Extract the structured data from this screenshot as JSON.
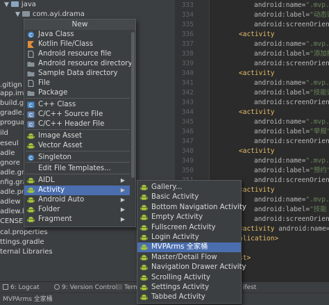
{
  "project_tree": {
    "java_label": "java",
    "package_label": "com.ayi.drama",
    "side_labels": [
      ".gitign",
      "app.im",
      "build.g",
      "gradle.",
      "proguar",
      "ild",
      "eseul",
      "adle",
      "gnore",
      "adle.gradl",
      "nfig.gradle",
      "adle.prop",
      "adlew",
      "adlew.ba",
      "CENSE",
      "cal.properties",
      "ttings.gradle",
      "ternal Libraries"
    ]
  },
  "editor": {
    "line_numbers": [
      "333",
      "334",
      "335",
      "336",
      "337",
      "338",
      "339",
      "340",
      "341",
      "342",
      "343",
      "344",
      "345",
      "346",
      "347",
      "348",
      "349",
      "350",
      "351",
      "352",
      "353",
      "354",
      "355",
      "356",
      "357",
      "358",
      "359",
      "360",
      "361",
      "362",
      "363",
      "364",
      "365",
      "366",
      "367",
      "368",
      "369",
      "370",
      "371",
      "372"
    ],
    "lines": [
      {
        "indent": 2,
        "attr": "android:name=",
        "val": "\".mvp.u"
      },
      {
        "indent": 2,
        "attr": "android:label=",
        "val": "\"动态详"
      },
      {
        "indent": 2,
        "attr": "android:screenOrienta",
        "val": ""
      },
      {
        "indent": 0,
        "tag": "<activity",
        "val": ""
      },
      {
        "indent": 2,
        "attr": "android:name=",
        "val": "\".mvp.u"
      },
      {
        "indent": 2,
        "attr": "android:label=",
        "val": "\"添加技"
      },
      {
        "indent": 2,
        "attr": "android:screenOrienta",
        "val": ""
      },
      {
        "indent": 0,
        "tag": "<activity",
        "val": ""
      },
      {
        "indent": 2,
        "attr": "android:name=",
        "val": "\".mvp.u"
      },
      {
        "indent": 2,
        "attr": "android:label=",
        "val": "\"技能详"
      },
      {
        "indent": 2,
        "attr": "android:screenOrienta",
        "val": ""
      },
      {
        "indent": 0,
        "tag": "<activity",
        "val": ""
      },
      {
        "indent": 2,
        "attr": "android:name=",
        "val": "\".mvp.u"
      },
      {
        "indent": 2,
        "attr": "android:label=",
        "val": "\"举报\""
      },
      {
        "indent": 2,
        "attr": "android:screenOrienta",
        "val": ""
      },
      {
        "indent": 0,
        "tag": "<activity",
        "val": ""
      },
      {
        "indent": 2,
        "attr": "android:name=",
        "val": "\".mvp.u"
      },
      {
        "indent": 2,
        "attr": "android:label=",
        "val": "\"预约\""
      },
      {
        "indent": 2,
        "attr": "android:screenOrienta",
        "val": ""
      },
      {
        "indent": 0,
        "tag": "<activity",
        "val": ""
      },
      {
        "indent": 2,
        "attr": "android:name=",
        "val": "\".mvp.u"
      },
      {
        "indent": 2,
        "attr": "android:label=",
        "val": "\"技能"
      },
      {
        "indent": 2,
        "attr": "android:screenOrienta",
        "val": ""
      },
      {
        "indent": 0,
        "tag": "<activity",
        "attr": " android:name=",
        "val": "\"."
      },
      {
        "indent": 0,
        "tag": "plication>",
        "val": ""
      },
      {
        "indent": 0,
        "tag": "",
        "val": ""
      },
      {
        "indent": 0,
        "tag": "st>",
        "val": ""
      }
    ]
  },
  "new_menu": {
    "title": "New",
    "items": [
      {
        "label": "Java Class",
        "icon": "java-class-icon",
        "color": "#4a88c7"
      },
      {
        "label": "Kotlin File/Class",
        "icon": "kotlin-icon",
        "color": "#e08d3c"
      },
      {
        "label": "Android resource file",
        "icon": "android-resource-file-icon",
        "color": "#a9b7c6"
      },
      {
        "label": "Android resource directory",
        "icon": "folder-icon",
        "color": "#87939a"
      },
      {
        "label": "Sample Data directory",
        "icon": "folder-icon",
        "color": "#87939a"
      },
      {
        "label": "File",
        "icon": "file-icon",
        "color": "#a9b7c6"
      },
      {
        "label": "Package",
        "icon": "package-icon",
        "color": "#87939a"
      },
      {
        "label": "C++ Class",
        "icon": "cpp-class-icon",
        "color": "#4a88c7"
      },
      {
        "label": "C/C++ Source File",
        "icon": "cpp-source-icon",
        "color": "#6a8bbb"
      },
      {
        "label": "C/C++ Header File",
        "icon": "cpp-header-icon",
        "color": "#6a8bbb"
      },
      {
        "label": "Image Asset",
        "icon": "android-icon",
        "color": "#a4c639"
      },
      {
        "label": "Vector Asset",
        "icon": "android-icon",
        "color": "#a4c639"
      },
      {
        "label": "Singleton",
        "icon": "singleton-icon",
        "color": "#4a88c7"
      },
      {
        "label": "Edit File Templates...",
        "icon": "",
        "color": ""
      },
      {
        "label": "AIDL",
        "icon": "android-icon",
        "color": "#a4c639"
      },
      {
        "label": "Activity",
        "icon": "android-icon",
        "color": "#a4c639"
      },
      {
        "label": "Android Auto",
        "icon": "android-icon",
        "color": "#a4c639"
      },
      {
        "label": "Folder",
        "icon": "android-icon",
        "color": "#a4c639"
      },
      {
        "label": "Fragment",
        "icon": "android-icon",
        "color": "#a4c639"
      }
    ],
    "selected": "Activity"
  },
  "activity_menu": {
    "items": [
      {
        "label": "Gallery..."
      },
      {
        "label": "Basic Activity"
      },
      {
        "label": "Bottom Navigation Activity"
      },
      {
        "label": "Empty Activity"
      },
      {
        "label": "Fullscreen Activity"
      },
      {
        "label": "Login Activity"
      },
      {
        "label": "MVPArms 全家桶"
      },
      {
        "label": "Master/Detail Flow"
      },
      {
        "label": "Navigation Drawer Activity"
      },
      {
        "label": "Scrolling Activity"
      },
      {
        "label": "Settings Activity"
      },
      {
        "label": "Tabbed Activity"
      }
    ],
    "selected": "MVPArms 全家桶"
  },
  "bottom_bar": {
    "logcat": "6: Logcat",
    "version_control": "9: Version Control",
    "terminal": "Term",
    "manifest": "ifest"
  },
  "status_bar": {
    "text": "MVPArms 全家桶"
  },
  "colors": {
    "selection": "#4b6eaf",
    "android_green": "#a4c639"
  }
}
